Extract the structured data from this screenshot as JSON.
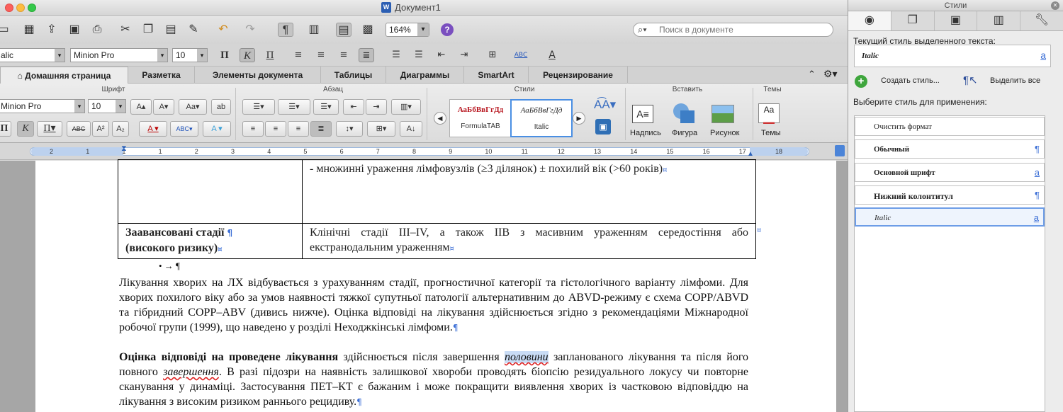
{
  "window": {
    "title": "Документ1",
    "doc_icon": "W"
  },
  "toolbar": {
    "zoom": "164%",
    "search_placeholder": "Поиск в документе"
  },
  "format_bar": {
    "style_value": "alic",
    "font_value": "Minion Pro",
    "size_value": "10"
  },
  "ribbon": {
    "tabs": [
      {
        "label": "Домашняя страница",
        "active": true
      },
      {
        "label": "Разметка"
      },
      {
        "label": "Элементы документа"
      },
      {
        "label": "Таблицы"
      },
      {
        "label": "Диаграммы"
      },
      {
        "label": "SmartArt"
      },
      {
        "label": "Рецензирование"
      }
    ],
    "groups": {
      "font": "Шрифт",
      "paragraph": "Абзац",
      "styles": "Стили",
      "insert": "Вставить",
      "themes": "Темы"
    },
    "font_name": "Minion Pro",
    "font_size": "10",
    "style_gallery": [
      {
        "preview": "АаБбВвГгДд",
        "name": "FormulaTAB"
      },
      {
        "preview": "АаБбВвГгДд",
        "name": "Italic"
      }
    ],
    "insert_buttons": [
      "Надпись",
      "Фигура",
      "Рисунок"
    ],
    "themes_button": "Темы"
  },
  "ruler": {
    "numbers": [
      "2",
      "1",
      "1",
      "1",
      "2",
      "3",
      "4",
      "5",
      "6",
      "7",
      "8",
      "9",
      "10",
      "11",
      "12",
      "13",
      "14",
      "15",
      "16",
      "17",
      "18"
    ]
  },
  "document": {
    "table_row1_right": "- множинні ураження лімфовузлів (≥3 ділянок) ± похилий вік (>60 років)",
    "table_row2_left_line1": "Заавансовані стадії",
    "table_row2_left_line2": "(високого ризику)",
    "table_row2_right": "Клінічні стадії III–IV, а також IIB з масивним ураженням середостіння або екстранодальним ураженням",
    "bullet_line": "•  →  ¶",
    "para1": "Лікування хворих на ЛХ відбувається з урахуванням стадії, прогностичної категорії та гістологічного варіанту лімфоми. Для хворих похилого віку або за умов наявності тяжкої супутньої патології альтернативним до ABVD-режиму є схема COPP/ABVD та гібридний COPP–ABV (дивись нижче). Оцінка відповіді на лікування здійснюється згідно з рекомендаціями Міжнародної робочої групи (1999), що наведено у розділі Неходжкінські лімфоми.",
    "para2_bold": "Оцінка відповіді на проведене лікування",
    "para2_a": " здійснюється після завершення ",
    "para2_italic_hl": "половини",
    "para2_b": " запланованого лікування та після його повного ",
    "para2_italic_u": "завершення",
    "para2_c": ". В разі підозри на наявність залишкової хвороби проводять біопсію резидуального локусу чи повторне сканування у динаміці. Застосування ПЕТ–КТ є бажаним і може покращити виявлення хворих із частковою відповіддю на лікування з високим ризиком раннього рецидиву.",
    "pilcrow": "¶",
    "cell_mark": "¤"
  },
  "palette": {
    "title": "Стили",
    "current_label": "Текущий стиль выделенного текста:",
    "current_value": "Italic",
    "create_button": "Создать стиль...",
    "select_all_button": "Выделить все",
    "apply_label": "Выберите стиль для применения:",
    "styles": [
      {
        "name": "Очистить формат",
        "icon": ""
      },
      {
        "name": "Обычный",
        "icon": "¶"
      },
      {
        "name": "Основной шрифт",
        "icon": "a"
      },
      {
        "name": "Нижний колонтитул",
        "icon": "¶"
      },
      {
        "name": "Italic",
        "icon": "a",
        "selected": true
      }
    ]
  }
}
